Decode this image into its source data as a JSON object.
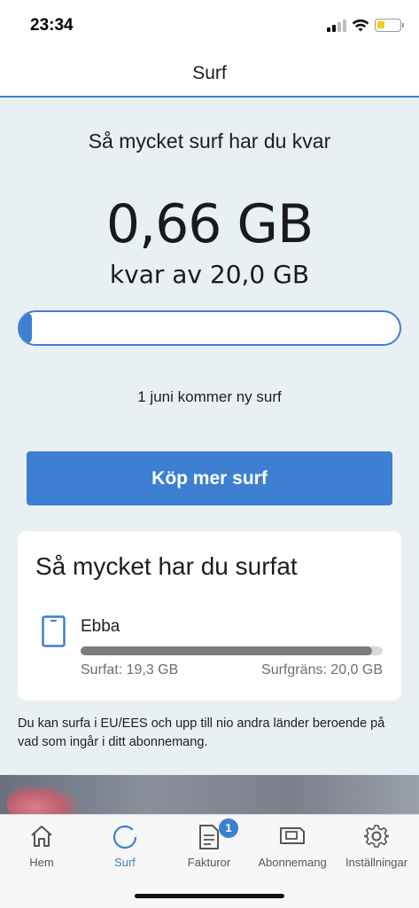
{
  "status_bar": {
    "time": "23:34",
    "icons": [
      "cellular-signal-icon",
      "wifi-icon",
      "battery-icon"
    ],
    "battery_level": 0.3
  },
  "header": {
    "title": "Surf"
  },
  "summary": {
    "title": "Så mycket surf har du kvar",
    "remaining": "0,66 GB",
    "of_total": "kvar av 20,0 GB",
    "remaining_fraction": 0.033,
    "refill_note": "1 juni kommer ny surf"
  },
  "buy_button": {
    "label": "Köp mer surf"
  },
  "usage_card": {
    "title": "Så mycket har du surfat",
    "user_name": "Ebba",
    "used_fraction": 0.965,
    "used_label": "Surfat: 19,3 GB",
    "limit_label": "Surfgräns: 20,0 GB"
  },
  "eu_note": "Du kan surfa i EU/EES och upp till nio andra länder beroende på vad som ingår i ditt abonnemang.",
  "tabs": [
    {
      "label": "Hem",
      "icon": "home-icon",
      "active": false
    },
    {
      "label": "Surf",
      "icon": "surf-ring-icon",
      "active": true
    },
    {
      "label": "Fakturor",
      "icon": "invoice-icon",
      "active": false,
      "badge": "1"
    },
    {
      "label": "Abonnemang",
      "icon": "sim-card-icon",
      "active": false
    },
    {
      "label": "Inställningar",
      "icon": "gear-icon",
      "active": false
    }
  ],
  "colors": {
    "accent": "#3d7fd0",
    "background": "#e8f0f3",
    "usage_fill": "#7c7c7c"
  }
}
